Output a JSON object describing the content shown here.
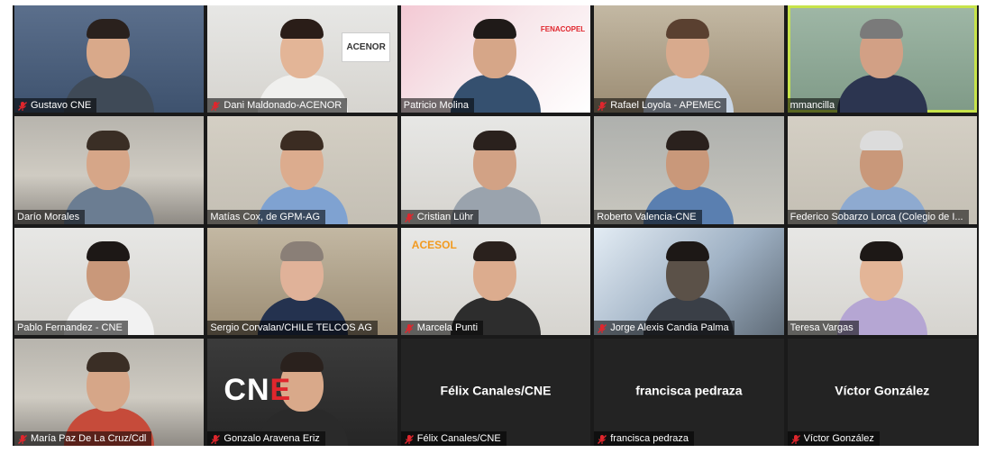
{
  "meeting": {
    "participants": [
      {
        "name": "Gustavo CNE",
        "bg": "bg-blue",
        "shirt": "#3f4a57",
        "skin": "#d9a98a",
        "hair": "#2a211d",
        "muted": true,
        "active": false
      },
      {
        "name": "Dani Maldonado-ACENOR",
        "bg": "bg-white",
        "shirt": "#f0f0ee",
        "skin": "#e3b597",
        "hair": "#2a1d18",
        "muted": true,
        "active": false,
        "logo": "ACENOR"
      },
      {
        "name": "Patricio Molina",
        "bg": "bg-pink",
        "shirt": "#35506f",
        "skin": "#d6a688",
        "hair": "#1f1a18",
        "muted": false,
        "active": false,
        "logo": "FENACOPEL"
      },
      {
        "name": "Rafael Loyola - APEMEC",
        "bg": "bg-shelf",
        "shirt": "#c9d6e6",
        "skin": "#d8aa8d",
        "hair": "#5a4030",
        "muted": true,
        "active": false
      },
      {
        "name": "mmancilla",
        "bg": "bg-green",
        "shirt": "#2c3550",
        "skin": "#d2a085",
        "hair": "#7a7a7a",
        "muted": false,
        "active": true
      },
      {
        "name": "Darío Morales",
        "bg": "bg-room",
        "shirt": "#6b7d92",
        "skin": "#d6a688",
        "hair": "#3a2e25",
        "muted": false,
        "active": false
      },
      {
        "name": "Matías Cox, de GPM-AG",
        "bg": "bg-wall",
        "shirt": "#7fa2d1",
        "skin": "#dcac8e",
        "hair": "#3b2c22",
        "muted": false,
        "active": false
      },
      {
        "name": "Cristian Lühr",
        "bg": "bg-white",
        "shirt": "#9aa3ad",
        "skin": "#d2a285",
        "hair": "#2a211d",
        "muted": true,
        "active": false
      },
      {
        "name": "Roberto Valencia-CNE",
        "bg": "bg-brick",
        "shirt": "#5a7fb0",
        "skin": "#c9987a",
        "hair": "#2a211d",
        "muted": false,
        "active": false
      },
      {
        "name": "Federico Sobarzo Lorca (Colegio de I...",
        "bg": "bg-wall",
        "shirt": "#8eaad0",
        "skin": "#c9987a",
        "hair": "#dcdcdc",
        "muted": false,
        "active": false
      },
      {
        "name": "Pablo Fernandez - CNE",
        "bg": "bg-white",
        "shirt": "#f2f2f2",
        "skin": "#c9987a",
        "hair": "#1d1816",
        "muted": false,
        "active": false
      },
      {
        "name": "Sergio Corvalan/CHILE TELCOS AG",
        "bg": "bg-shelf",
        "shirt": "#24324f",
        "skin": "#e0b299",
        "hair": "#8a7f77",
        "muted": false,
        "active": false
      },
      {
        "name": "Marcela Punti",
        "bg": "bg-white",
        "shirt": "#2d2d2d",
        "skin": "#dcac8e",
        "hair": "#2a211d",
        "muted": true,
        "active": false,
        "logo": "ACESOL"
      },
      {
        "name": "Jorge Alexis Candia Palma",
        "bg": "bg-window",
        "shirt": "#3a3f47",
        "skin": "#5b5148",
        "hair": "#1d1816",
        "muted": true,
        "active": false
      },
      {
        "name": "Teresa Vargas",
        "bg": "bg-white",
        "shirt": "#b5a6d3",
        "skin": "#e3b597",
        "hair": "#1d1816",
        "muted": false,
        "active": false
      },
      {
        "name": "María Paz De La Cruz/Cdl",
        "bg": "bg-room",
        "shirt": "#c64b3a",
        "skin": "#d6a688",
        "hair": "#3a2e25",
        "muted": true,
        "active": false
      },
      {
        "name": "Gonzalo Aravena Eriz",
        "bg": "bg-dark",
        "shirt": "#2a2a2a",
        "skin": "#d9a98a",
        "hair": "#2a211d",
        "muted": true,
        "active": false,
        "logo": "CNE"
      },
      {
        "name": "Félix Canales/CNE",
        "bg": "bg-empty",
        "muted": true,
        "active": false,
        "video_off": true,
        "display": "Félix Canales/CNE"
      },
      {
        "name": "francisca pedraza",
        "bg": "bg-empty",
        "muted": true,
        "active": false,
        "video_off": true,
        "display": "francisca pedraza"
      },
      {
        "name": "Víctor González",
        "bg": "bg-empty",
        "muted": true,
        "active": false,
        "video_off": true,
        "display": "Víctor González"
      }
    ],
    "colors": {
      "active_speaker": "#c7e34a",
      "muted_icon": "#e0262d",
      "cne_red": "#e0262d"
    },
    "icons": {
      "muted": "microphone-muted-icon"
    }
  }
}
